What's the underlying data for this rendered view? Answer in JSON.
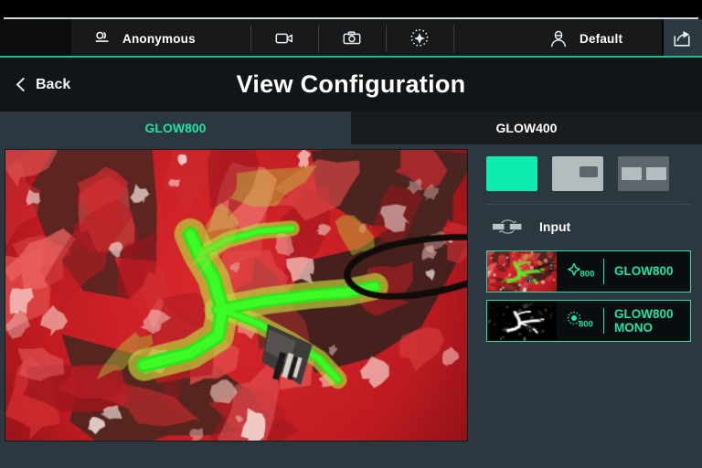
{
  "toolbar": {
    "patient_label": "Anonymous",
    "patient_icon": "patient-id-icon",
    "video_icon": "video-record-icon",
    "photo_icon": "photo-capture-icon",
    "light_icon": "illumination-icon",
    "surgeon_icon": "surgeon-profile-icon",
    "surgeon_label": "Default",
    "share_icon": "share-export-icon"
  },
  "header": {
    "back_label": "Back",
    "back_icon": "chevron-left-icon",
    "title": "View Configuration"
  },
  "tabs": [
    {
      "label": "GLOW800",
      "active": true
    },
    {
      "label": "GLOW400",
      "active": false
    }
  ],
  "panel": {
    "layouts": [
      {
        "name": "single-view",
        "label": "Single",
        "active": true
      },
      {
        "name": "picture-in-picture",
        "label": "Picture in Picture",
        "active": false
      },
      {
        "name": "split-screen",
        "label": "Split Screen",
        "active": false
      }
    ],
    "input_section": {
      "icon": "swap-input-icon",
      "label": "Input"
    },
    "sources": [
      {
        "name": "GLOW800",
        "icon": "sparkle-800-icon",
        "icon_badge": "800",
        "selected": true,
        "thumb": "fluorescence-color-thumbnail"
      },
      {
        "name": "GLOW800 MONO",
        "name_line1": "GLOW800",
        "name_line2": "MONO",
        "icon": "dot-ring-800-icon",
        "icon_badge": "800",
        "selected": true,
        "thumb": "fluorescence-mono-thumbnail"
      }
    ]
  },
  "viewer": {
    "name": "endoscopic-fluorescence-video",
    "description": "Live surgical endoscope view with GLOW800 fluorescence overlay"
  },
  "colors": {
    "accent_teal": "#1fe3aa",
    "rule_teal": "#19c08e",
    "panel_bg": "#2b3840",
    "toolbar_bg": "#17191b",
    "header_bg": "#121517",
    "tab_inactive_bg": "#191c1f"
  }
}
